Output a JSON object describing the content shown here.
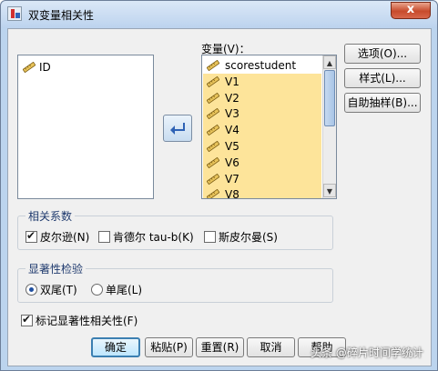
{
  "window": {
    "title": "双变量相关性",
    "close_label": "x"
  },
  "source_list": {
    "items": [
      {
        "label": "ID",
        "icon": "ruler-icon"
      }
    ]
  },
  "move_button": {
    "icon": "arrow-left-icon"
  },
  "variables": {
    "label": "变量(V)：",
    "items": [
      {
        "label": "scorestudent",
        "icon": "ruler-icon",
        "selected": false
      },
      {
        "label": "V1",
        "icon": "ruler-icon",
        "selected": true
      },
      {
        "label": "V2",
        "icon": "ruler-icon",
        "selected": true
      },
      {
        "label": "V3",
        "icon": "ruler-icon",
        "selected": true
      },
      {
        "label": "V4",
        "icon": "ruler-icon",
        "selected": true
      },
      {
        "label": "V5",
        "icon": "ruler-icon",
        "selected": true
      },
      {
        "label": "V6",
        "icon": "ruler-icon",
        "selected": true
      },
      {
        "label": "V7",
        "icon": "ruler-icon",
        "selected": true
      },
      {
        "label": "V8",
        "icon": "ruler-icon",
        "selected": true
      }
    ]
  },
  "side_buttons": {
    "options": "选项(O)...",
    "style": "样式(L)...",
    "bootstrap": "自助抽样(B)..."
  },
  "coefficients": {
    "title": "相关系数",
    "pearson": {
      "label": "皮尔逊(N)",
      "checked": true
    },
    "kendall": {
      "label": "肯德尔 tau-b(K)",
      "checked": false
    },
    "spearman": {
      "label": "斯皮尔曼(S)",
      "checked": false
    }
  },
  "significance": {
    "title": "显著性检验",
    "two_tailed": {
      "label": "双尾(T)",
      "selected": true
    },
    "one_tailed": {
      "label": "单尾(L)",
      "selected": false
    }
  },
  "flag": {
    "label": "标记显著性相关性(F)",
    "checked": true
  },
  "footer": {
    "ok": "确定",
    "paste": "粘贴(P)",
    "reset": "重置(R)",
    "cancel": "取消",
    "help": "帮助"
  },
  "watermark": "头条 @碎片时间学统计"
}
